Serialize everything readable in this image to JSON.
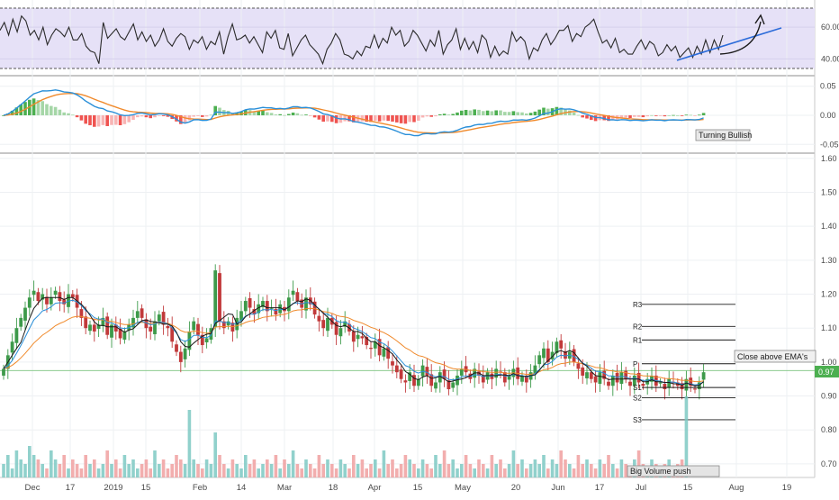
{
  "chart_data": [
    {
      "type": "line",
      "panel": "RSI",
      "y_ticks": [
        "60.00",
        "40.00"
      ],
      "series": [
        {
          "values": [
            58,
            63,
            55,
            65,
            57,
            67,
            64,
            55,
            58,
            52,
            60,
            49,
            55,
            59,
            57,
            54,
            60,
            52,
            52,
            56,
            48,
            45,
            44,
            37,
            63,
            53,
            56,
            59,
            54,
            52,
            57,
            62,
            52,
            57,
            51,
            55,
            48,
            52,
            59,
            51,
            48,
            53,
            56,
            54,
            46,
            52,
            50,
            54,
            46,
            51,
            49,
            57,
            43,
            54,
            62,
            52,
            53,
            55,
            50,
            54,
            49,
            44,
            57,
            53,
            58,
            47,
            46,
            56,
            42,
            47,
            52,
            55,
            49,
            46,
            43,
            37,
            46,
            50,
            56,
            52,
            43,
            42,
            40,
            45,
            42,
            48,
            47,
            55,
            47,
            53,
            50,
            60,
            55,
            58,
            48,
            51,
            58,
            55,
            50,
            45,
            52,
            48,
            58,
            43,
            49,
            52,
            59,
            46,
            53,
            46,
            51,
            44,
            55,
            52,
            41,
            48,
            42,
            45,
            43,
            57,
            51,
            54,
            51,
            40,
            47,
            45,
            52,
            56,
            49,
            53,
            58,
            58,
            61,
            51,
            56,
            54,
            60,
            62,
            65,
            57,
            50,
            52,
            47,
            53,
            44,
            46,
            43,
            43,
            48,
            52,
            46,
            51,
            49,
            42,
            44,
            49,
            45,
            48,
            41,
            44,
            47,
            41,
            48,
            43,
            52,
            44,
            52,
            46,
            55
          ]
        }
      ],
      "ylim": [
        34,
        72
      ],
      "annotations": [
        "trendline-rising",
        "arrow-up"
      ]
    },
    {
      "type": "bar",
      "panel": "MACD",
      "y_ticks": [
        "0.05",
        "0.00",
        "-0.05"
      ],
      "ylim": [
        -0.062,
        0.062
      ],
      "annotations": [
        "Turning Bullish"
      ]
    },
    {
      "type": "candlestick",
      "panel": "Price",
      "y_ticks": [
        "1.60",
        "1.50",
        "1.40",
        "1.30",
        "1.20",
        "1.10",
        "1.00",
        "0.90",
        "0.80",
        "0.70"
      ],
      "x_ticks": [
        "Dec",
        "17",
        "2019",
        "15",
        "Feb",
        "14",
        "Mar",
        "18",
        "Apr",
        "15",
        "May",
        "20",
        "Jun",
        "17",
        "Jul",
        "15",
        "Aug",
        "19"
      ],
      "ylim": [
        0.66,
        1.61
      ],
      "last_price": "0.97",
      "closes": [
        0.98,
        1.02,
        1.06,
        1.1,
        1.13,
        1.16,
        1.19,
        1.21,
        1.18,
        1.2,
        1.17,
        1.19,
        1.21,
        1.18,
        1.17,
        1.2,
        1.19,
        1.16,
        1.13,
        1.1,
        1.11,
        1.09,
        1.11,
        1.13,
        1.08,
        1.11,
        1.09,
        1.07,
        1.09,
        1.11,
        1.13,
        1.15,
        1.13,
        1.1,
        1.09,
        1.12,
        1.14,
        1.11,
        1.1,
        1.06,
        1.03,
        1.0,
        1.04,
        1.09,
        1.12,
        1.08,
        1.05,
        1.07,
        1.1,
        1.27,
        1.12,
        1.1,
        1.12,
        1.09,
        1.13,
        1.15,
        1.18,
        1.16,
        1.14,
        1.17,
        1.18,
        1.15,
        1.16,
        1.14,
        1.17,
        1.15,
        1.19,
        1.21,
        1.18,
        1.16,
        1.19,
        1.17,
        1.14,
        1.12,
        1.1,
        1.13,
        1.11,
        1.08,
        1.1,
        1.12,
        1.09,
        1.06,
        1.08,
        1.07,
        1.05,
        1.04,
        1.06,
        1.02,
        1.04,
        1.01,
        0.99,
        0.97,
        0.95,
        0.94,
        0.97,
        0.93,
        0.95,
        0.99,
        0.96,
        0.93,
        0.94,
        0.97,
        0.95,
        0.92,
        0.94,
        0.96,
        0.98,
        0.97,
        0.95,
        0.98,
        0.96,
        0.94,
        0.97,
        0.95,
        0.98,
        0.97,
        0.94,
        0.96,
        0.98,
        0.95,
        0.96,
        0.94,
        0.97,
        0.99,
        1.02,
        1.04,
        1.0,
        1.03,
        1.06,
        1.04,
        1.01,
        1.03,
        1.0,
        0.98,
        0.96,
        0.97,
        0.95,
        0.94,
        0.97,
        0.95,
        0.93,
        0.96,
        0.94,
        0.97,
        0.95,
        0.93,
        0.96,
        0.94,
        0.93,
        0.95,
        0.96,
        0.93,
        0.94,
        0.92,
        0.95,
        0.94,
        0.93,
        0.92,
        0.95,
        0.93,
        0.92,
        0.94,
        0.97
      ]
    },
    {
      "type": "bar",
      "panel": "Volume",
      "values": [
        3,
        5,
        2,
        6,
        4,
        3,
        7,
        5,
        4,
        3,
        2,
        6,
        4,
        3,
        5,
        2,
        4,
        3,
        2,
        5,
        3,
        4,
        2,
        3,
        6,
        3,
        4,
        2,
        5,
        3,
        4,
        2,
        3,
        4,
        2,
        6,
        3,
        4,
        2,
        3,
        5,
        4,
        3,
        15,
        4,
        3,
        2,
        4,
        3,
        10,
        5,
        3,
        2,
        4,
        3,
        2,
        5,
        3,
        4,
        2,
        3,
        4,
        3,
        5,
        2,
        4,
        3,
        6,
        3,
        2,
        4,
        3,
        2,
        5,
        3,
        4,
        3,
        2,
        4,
        3,
        2,
        5,
        3,
        4,
        2,
        3,
        4,
        2,
        6,
        3,
        4,
        2,
        3,
        5,
        4,
        3,
        2,
        4,
        3,
        2,
        5,
        3,
        6,
        3,
        4,
        2,
        3,
        5,
        3,
        2,
        4,
        3,
        2,
        5,
        3,
        4,
        2,
        3,
        6,
        3,
        4,
        2,
        3,
        4,
        3,
        5,
        2,
        4,
        3,
        6,
        4,
        3,
        2,
        5,
        3,
        4,
        3,
        2,
        4,
        3,
        5,
        3,
        2,
        4,
        3,
        2,
        4,
        6,
        3,
        2,
        4,
        3,
        2,
        3,
        4,
        2,
        3,
        4,
        18
      ],
      "volume_ticks_hidden": true,
      "annotations": [
        "Big Volume push"
      ]
    }
  ],
  "pivots": [
    {
      "label": "R3",
      "value": 1.17
    },
    {
      "label": "R2",
      "value": 1.105
    },
    {
      "label": "R1",
      "value": 1.065
    },
    {
      "label": "P",
      "value": 0.995
    },
    {
      "label": "S1",
      "value": 0.925
    },
    {
      "label": "S2",
      "value": 0.895
    },
    {
      "label": "S3",
      "value": 0.83
    }
  ],
  "labels": {
    "close_above": "Close above EMA's",
    "turning_bullish": "Turning Bullish",
    "big_volume": "Big Volume push"
  },
  "colors": {
    "up": "#3d9a4a",
    "down": "#c1393a",
    "ema_fast": "#2a8fd8",
    "ema_slow": "#f08a2c",
    "ma_black": "#1a1a1a",
    "rsi_fill": "#e4dff5",
    "macd_pos": "#4caf50",
    "macd_neg": "#ef5350",
    "volume_teal": "#7ec9c3",
    "volume_pink": "#f0a0a0",
    "last_price_bg": "#4caf50",
    "trend_blue": "#2b6bd9"
  }
}
